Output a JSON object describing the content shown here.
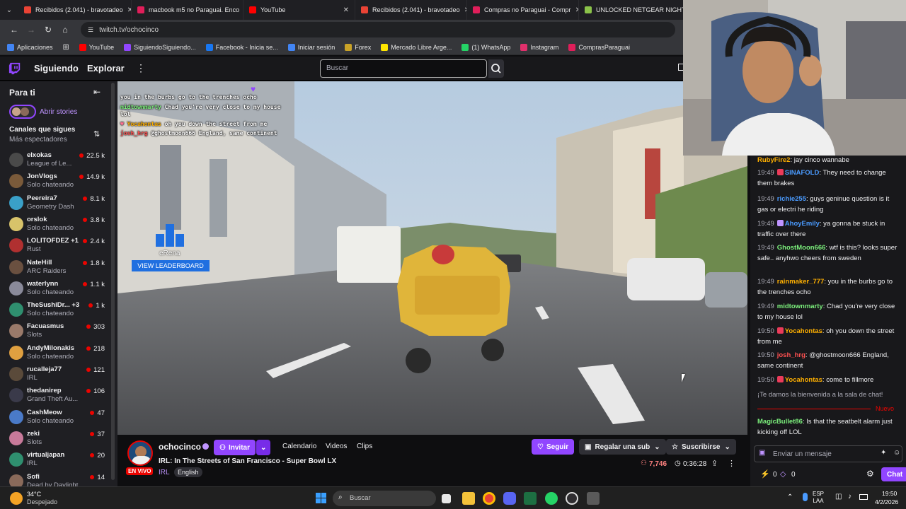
{
  "browser": {
    "tabs": [
      {
        "label": "Recibidos (2.041) - bravotadeo",
        "color": "#ea4335"
      },
      {
        "label": "macbook m5 no Paraguai. Enco",
        "color": "#e01e5a"
      },
      {
        "label": "YouTube",
        "color": "#ff0000"
      },
      {
        "label": "Recibidos (2.041) - bravotadeo",
        "color": "#ea4335"
      },
      {
        "label": "Compras no Paraguai - Compr",
        "color": "#e01e5a"
      },
      {
        "label": "UNLOCKED NETGEAR NIGHTH",
        "color": "#8bc34a"
      }
    ],
    "url": "twitch.tv/ochocinco",
    "bookmarks": [
      {
        "label": "Aplicaciones",
        "color": "#4285f4"
      },
      {
        "label": "YouTube",
        "color": "#ff0000"
      },
      {
        "label": "SiguiendoSiguiendo...",
        "color": "#9146ff"
      },
      {
        "label": "Facebook - Inicia se...",
        "color": "#1877f2"
      },
      {
        "label": "Iniciar sesión",
        "color": "#4285f4"
      },
      {
        "label": "Forex",
        "color": "#c9a227"
      },
      {
        "label": "Mercado Libre Arge...",
        "color": "#ffe600"
      },
      {
        "label": "(1) WhatsApp",
        "color": "#25d366"
      },
      {
        "label": "Instagram",
        "color": "#e1306c"
      },
      {
        "label": "ComprasParaguai",
        "color": "#e01e5a"
      }
    ]
  },
  "nav": {
    "following": "Siguiendo",
    "browse": "Explorar",
    "search_placeholder": "Buscar"
  },
  "sidebar": {
    "title": "Para ti",
    "stories": "Abrir stories",
    "followed_heading": "Canales que sigues",
    "followed_sub": "Más espectadores",
    "channels": [
      {
        "name": "elxokas",
        "game": "League of Le...",
        "viewers": "22.5 k",
        "color": "#4a4a4a"
      },
      {
        "name": "JonVlogs",
        "game": "Solo chateando",
        "viewers": "14.9 k",
        "color": "#7a5a3a"
      },
      {
        "name": "Peereira7",
        "game": "Geometry Dash",
        "viewers": "8.1 k",
        "color": "#3aa0c8"
      },
      {
        "name": "orslok",
        "game": "Solo chateando",
        "viewers": "3.8 k",
        "color": "#d8c36a"
      },
      {
        "name": "LOLITOFDEZ +1",
        "game": "Rust",
        "viewers": "2.4 k",
        "color": "#b03030"
      },
      {
        "name": "NateHill",
        "game": "ARC Raiders",
        "viewers": "1.8 k",
        "color": "#6a5040"
      },
      {
        "name": "waterlynn",
        "game": "Solo chateando",
        "viewers": "1.1 k",
        "color": "#8a8a9a"
      },
      {
        "name": "TheSushiDr... +3",
        "game": "Solo chateando",
        "viewers": "1 k",
        "color": "#2f8f6f"
      },
      {
        "name": "Facuasmus",
        "game": "Slots",
        "viewers": "303",
        "color": "#9a7a6a"
      },
      {
        "name": "AndyMilonakis",
        "game": "Solo chateando",
        "viewers": "218",
        "color": "#e0a040"
      },
      {
        "name": "rucalleja77",
        "game": "IRL",
        "viewers": "121",
        "color": "#5a4a3a"
      },
      {
        "name": "thedanirep",
        "game": "Grand Theft Au...",
        "viewers": "106",
        "color": "#3a3a4a"
      },
      {
        "name": "CashMeow",
        "game": "Solo chateando",
        "viewers": "47",
        "color": "#4a7ac8"
      },
      {
        "name": "zeki",
        "game": "Slots",
        "viewers": "37",
        "color": "#c87a9a"
      },
      {
        "name": "virtualjapan",
        "game": "IRL",
        "viewers": "20",
        "color": "#2f8f6f"
      },
      {
        "name": "Sofi",
        "game": "Dead by Daylight",
        "viewers": "14",
        "color": "#8a6a5a"
      }
    ]
  },
  "overlay": {
    "chat": [
      {
        "user": "",
        "text": "you in the burbs go to the trenches ocho",
        "color": "#7cf07c"
      },
      {
        "user": "midtownmarty",
        "text": "Chad you're very close to my house lol",
        "color": "#7cf07c"
      },
      {
        "user": "Yocahontas",
        "text": "oh you down the street from me",
        "color": "#ffb000"
      },
      {
        "user": "josh_hrg",
        "text": "@ghostmoon666 England, same continent",
        "color": "#ff5050"
      }
    ],
    "erena": "eRena",
    "leaderboard": "VIEW LEADERBOARD"
  },
  "stream": {
    "channel": "ochocinco",
    "invite": "Invitar",
    "title": "IRL: In The Streets of San Francisco - Super Bowl LX",
    "live": "EN VIVO",
    "category": "IRL",
    "language": "English",
    "tabs": [
      "Calendario",
      "Videos",
      "Clips"
    ],
    "follow": "Seguir",
    "gift": "Regalar una sub",
    "subscribe": "Suscribirse",
    "viewers": "7,746",
    "uptime": "0:36:28"
  },
  "chat": {
    "messages": [
      {
        "time": "",
        "user": "RubyFire2",
        "text": "jay cinco wannabe",
        "color": "#ffb000"
      },
      {
        "time": "19:49",
        "user": "SINAFOLD",
        "text": "They need to change them brakes",
        "color": "#4a9bff",
        "badge": "#eb3b5a"
      },
      {
        "time": "19:49",
        "user": "richie255",
        "text": "guys geninue question is it gas or electri he riding",
        "color": "#4a9bff"
      },
      {
        "time": "19:49",
        "user": "AhoyEmily",
        "text": "ya gonna be stuck in traffic over there",
        "color": "#4a9bff",
        "badge": "#bf94ff"
      },
      {
        "time": "19:49",
        "user": "GhostMoon666",
        "text": "wtf is this? looks super safe.. anyhwo cheers from sweden",
        "color": "#7cf07c"
      },
      {
        "time": "19:49",
        "user": "rainmaker_777",
        "text": "you in the burbs go to the trenches ocho",
        "color": "#ffb000"
      },
      {
        "time": "19:49",
        "user": "midtownmarty",
        "text": "Chad you're very close to my house lol",
        "color": "#7cf07c"
      },
      {
        "time": "19:50",
        "user": "Yocahontas",
        "text": "oh you down the street from me",
        "color": "#ffb000",
        "badge": "#eb3b5a"
      },
      {
        "time": "19:50",
        "user": "josh_hrg",
        "text": "@ghostmoon666 England, same continent",
        "color": "#ff5050"
      },
      {
        "time": "19:50",
        "user": "Yocahontas",
        "text": "come to fillmore",
        "color": "#ffb000",
        "badge": "#eb3b5a"
      }
    ],
    "welcome": "¡Te damos la bienvenida a la sala de chat!",
    "new_label": "Nuevo",
    "last": {
      "user": "MagicBullet86",
      "text": "Is that the seatbelt alarm just kicking off LOL",
      "color": "#7cf07c"
    },
    "input_placeholder": "Enviar un mensaje",
    "points": "0",
    "bits": "0",
    "send": "Chat"
  },
  "taskbar": {
    "temp": "34°C",
    "weather": "Despejado",
    "search": "Buscar",
    "lang": "ESP",
    "layout": "LAA",
    "time": "19:50",
    "date": "4/2/2026"
  }
}
